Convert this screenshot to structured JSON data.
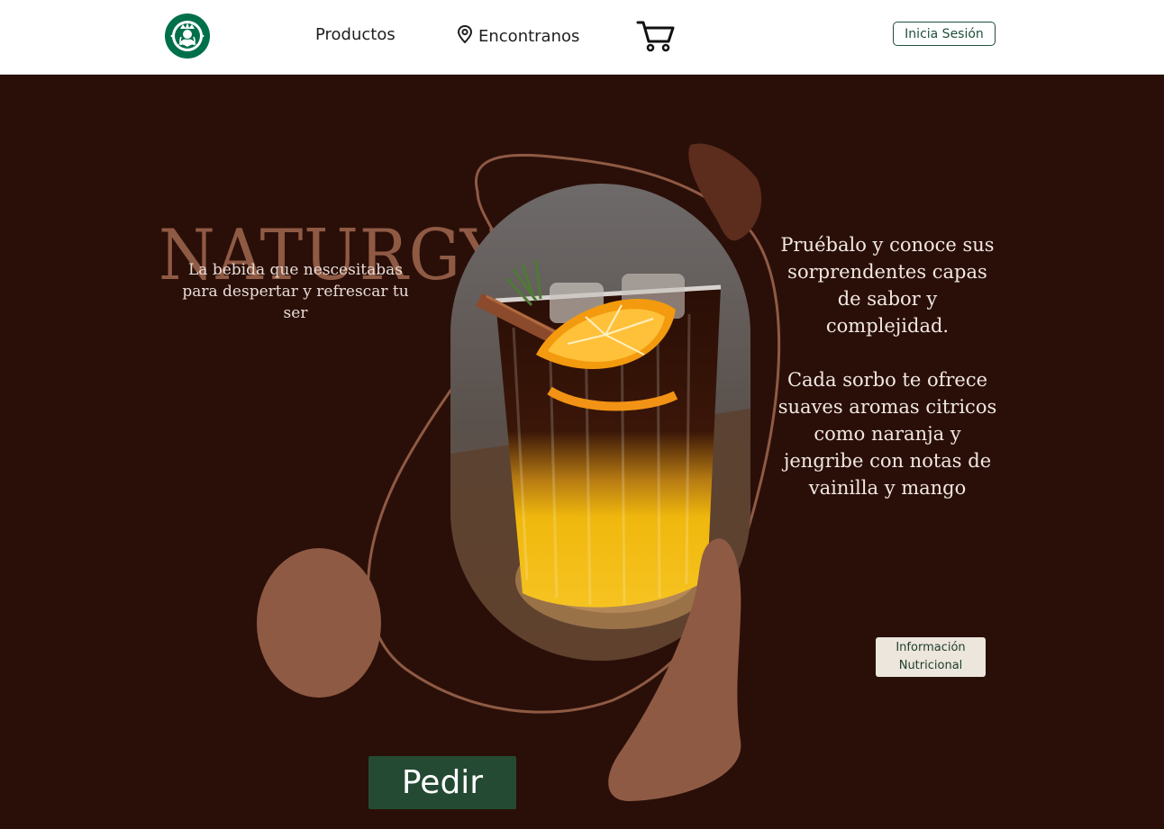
{
  "header": {
    "logo_icon": "starbucks-siren-logo-icon",
    "nav": {
      "productos": "Productos",
      "encontranos": "Encontranos",
      "location_icon": "location-pin-icon",
      "cart_icon": "shopping-cart-icon"
    },
    "login_label": "Inicia Sesión"
  },
  "hero": {
    "title": "NATURGY",
    "tagline": "La bebida que nescesitabas para despertar y refrescar tu ser",
    "description_1": "Pruébalo y conoce sus sorprendentes capas de sabor y complejidad.",
    "description_2": "Cada sorbo te ofrece suaves aromas citricos como naranja y jengribe con notas de vainilla y mango",
    "nutrition_label": "Información\nNutricional",
    "order_label": "Pedir"
  },
  "colors": {
    "background": "#2a0f08",
    "accent_brown": "#8f5a44",
    "order_green": "#244a33",
    "login_green": "#1f4f3a"
  }
}
